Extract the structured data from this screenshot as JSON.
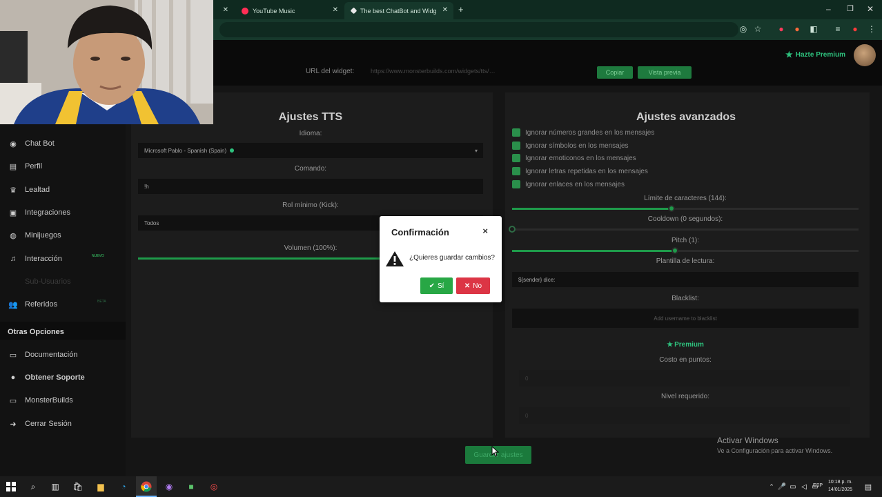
{
  "browser": {
    "tabs": [
      {
        "label": "",
        "active": false
      },
      {
        "label": "YouTube Music",
        "active": false
      },
      {
        "label": "The best ChatBot and Widgets",
        "active": false
      }
    ],
    "new_tab": "+",
    "window_controls": {
      "minimize": "–",
      "maximize": "❐",
      "close": "✕"
    }
  },
  "header": {
    "premium_label": "Hazte Premium"
  },
  "widget_bar": {
    "url_label": "URL del widget:",
    "url_value": "https://www.monsterbuilds.com/widgets/tts/…",
    "copy_button": "Copiar",
    "preview_button": "Vista previa"
  },
  "sidebar": {
    "items": [
      {
        "label": "Chat Bot",
        "icon": "robot-icon"
      },
      {
        "label": "Perfil",
        "icon": "id-card-icon"
      },
      {
        "label": "Lealtad",
        "icon": "trophy-icon"
      },
      {
        "label": "Integraciones",
        "icon": "integrations-icon"
      },
      {
        "label": "Minijuegos",
        "icon": "gamepad-icon"
      },
      {
        "label": "Interacción",
        "icon": "music-note-icon",
        "badge": "NUEVO"
      },
      {
        "label": "Sub-Usuarios",
        "icon": "",
        "disabled": true
      },
      {
        "label": "Referidos",
        "icon": "users-icon",
        "badge": "BETA"
      }
    ],
    "section_title": "Otras Opciones",
    "other_items": [
      {
        "label": "Documentación",
        "icon": "book-icon"
      },
      {
        "label": "Obtener Soporte",
        "icon": "support-icon"
      },
      {
        "label": "MonsterBuilds",
        "icon": "monitor-icon"
      },
      {
        "label": "Cerrar Sesión",
        "icon": "logout-icon"
      }
    ]
  },
  "tts": {
    "title": "Ajustes TTS",
    "language_label": "Idioma:",
    "language_value": "Microsoft Pablo - Spanish (Spain)",
    "command_label": "Comando:",
    "command_value": "!h",
    "role_label": "Rol mínimo (Kick):",
    "role_value": "Todos",
    "volume_label": "Volumen (100%):",
    "volume_level": 1.0
  },
  "advanced": {
    "title": "Ajustes avanzados",
    "options": [
      "Ignorar números grandes en los mensajes",
      "Ignorar símbolos en los mensajes",
      "Ignorar emoticonos en los mensajes",
      "Ignorar letras repetidas en los mensajes",
      "Ignorar enlaces en los mensajes"
    ],
    "char_limit_label": "Límite de caracteres (144):",
    "char_limit_level": 0.46,
    "cooldown_label": "Cooldown (0 segundos):",
    "cooldown_level": 0.0,
    "pitch_label": "Pitch (1):",
    "pitch_level": 0.47,
    "template_label": "Plantilla de lectura:",
    "template_value": "${sender} dice:",
    "blacklist_label": "Blacklist:",
    "blacklist_placeholder": "Add username to blacklist",
    "premium_label": "Premium",
    "cost_label": "Costo en puntos:",
    "cost_value": "0",
    "level_label": "Nivel requerido:",
    "level_value": "0"
  },
  "save_button": "Guardar ajustes",
  "dialog": {
    "title": "Confirmación",
    "close": "×",
    "message": "¿Quieres guardar cambios?",
    "yes": "Sí",
    "no": "No"
  },
  "watermark": {
    "title": "Activar Windows",
    "subtitle": "Ve a Configuración para activar Windows."
  },
  "taskbar": {
    "language": "ESP",
    "time": "10:18 p. m.",
    "date": "14/01/2025"
  },
  "colors": {
    "accent_green": "#1e9b4a",
    "premium_green": "#2ec27e",
    "dialog_yes": "#28a745",
    "dialog_no": "#dc3545"
  }
}
